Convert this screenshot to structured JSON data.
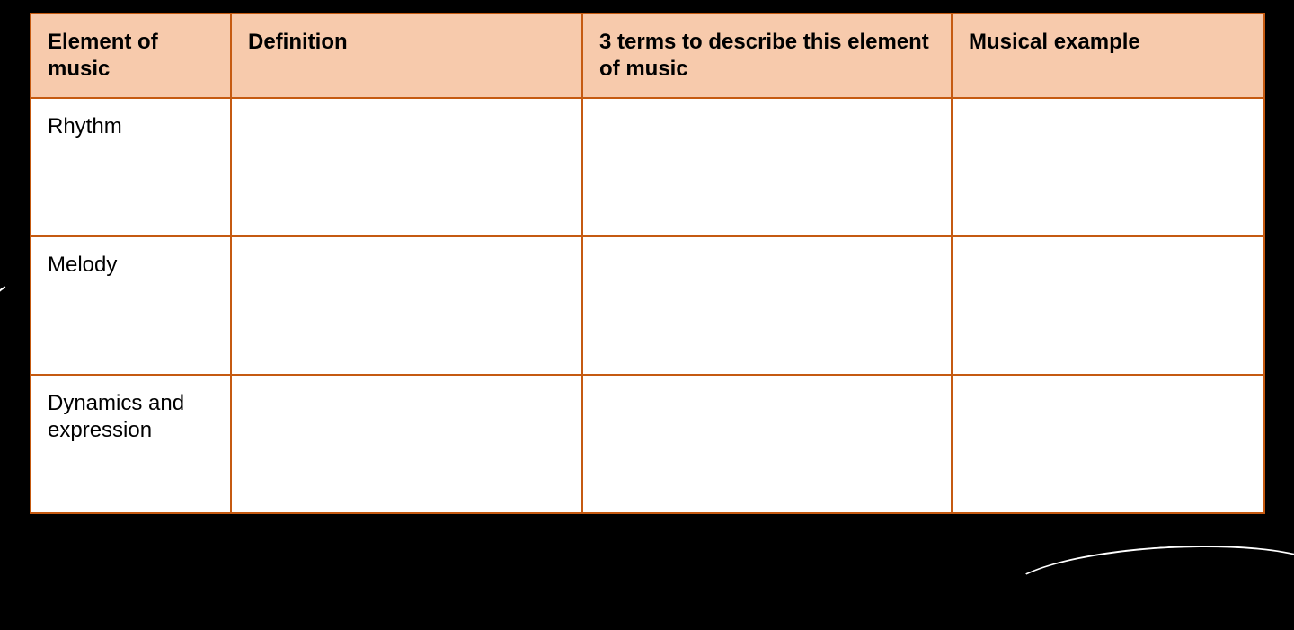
{
  "table": {
    "headers": {
      "col1": "Element of music",
      "col2": "Definition",
      "col3": "3 terms to describe this element of music",
      "col4": "Musical example"
    },
    "rows": [
      {
        "element": "Rhythm",
        "definition": "",
        "terms": "",
        "example": ""
      },
      {
        "element": "Melody",
        "definition": "",
        "terms": "",
        "example": ""
      },
      {
        "element": "Dynamics and expression",
        "definition": "",
        "terms": "",
        "example": ""
      }
    ]
  }
}
